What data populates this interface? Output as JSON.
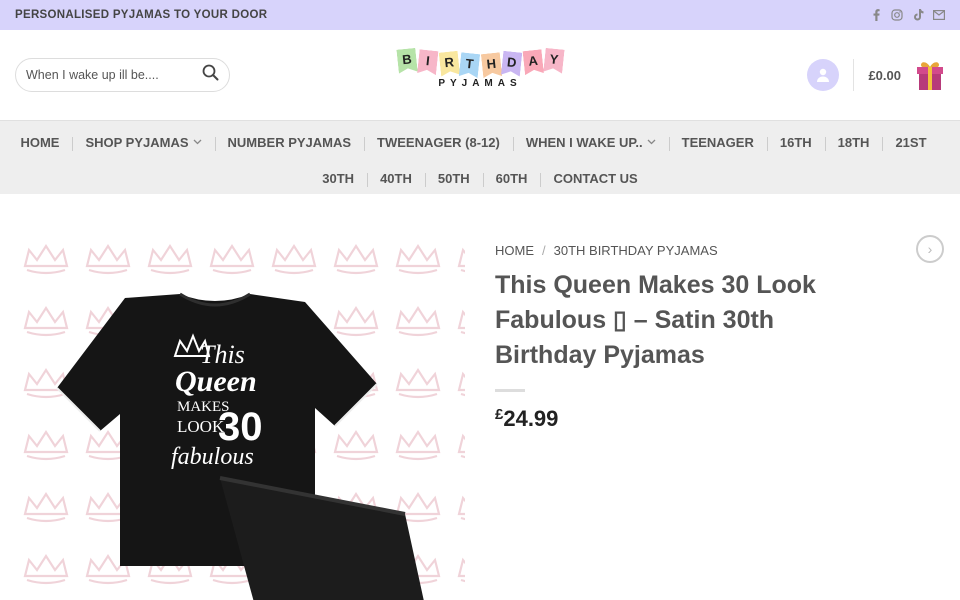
{
  "topbar": {
    "promo": "PERSONALISED PYJAMAS TO YOUR DOOR",
    "social": [
      "facebook-icon",
      "instagram-icon",
      "tiktok-icon",
      "email-icon"
    ]
  },
  "header": {
    "search_placeholder": "When I wake up ill be....",
    "logo_letters": [
      "B",
      "I",
      "R",
      "T",
      "H",
      "D",
      "A",
      "Y"
    ],
    "logo_colors": [
      "#b6e3a8",
      "#f7b6c8",
      "#f9e79f",
      "#a9d6f5",
      "#f7c9a0",
      "#c9b6f2",
      "#f9a8b8",
      "#f7b6c8"
    ],
    "logo_sub": "PYJAMAS",
    "cart_total": "£0.00"
  },
  "nav": {
    "row1": [
      {
        "label": "HOME",
        "dropdown": false
      },
      {
        "label": "SHOP PYJAMAS",
        "dropdown": true
      },
      {
        "label": "NUMBER PYJAMAS",
        "dropdown": false
      },
      {
        "label": "TWEENAGER (8-12)",
        "dropdown": false
      },
      {
        "label": "WHEN I WAKE UP..",
        "dropdown": true
      },
      {
        "label": "TEENAGER",
        "dropdown": false
      },
      {
        "label": "16TH",
        "dropdown": false
      },
      {
        "label": "18TH",
        "dropdown": false
      },
      {
        "label": "21ST",
        "dropdown": false
      }
    ],
    "row2": [
      {
        "label": "30TH",
        "dropdown": false
      },
      {
        "label": "40TH",
        "dropdown": false
      },
      {
        "label": "50TH",
        "dropdown": false
      },
      {
        "label": "60TH",
        "dropdown": false
      },
      {
        "label": "CONTACT US",
        "dropdown": false
      }
    ]
  },
  "product": {
    "breadcrumb_home": "HOME",
    "breadcrumb_sep": "/",
    "breadcrumb_category": "30TH BIRTHDAY PYJAMAS",
    "title": "This Queen Makes 30 Look Fabulous ▯ – Satin 30th Birthday Pyjamas",
    "price_currency": "£",
    "price_value": "24.99",
    "image_text": {
      "line1": "This",
      "line2": "Queen",
      "line3": "MAKES",
      "line4": "LOOK",
      "number": "30",
      "line5": "fabulous"
    }
  },
  "colors": {
    "topbar_bg": "#d7d3fb",
    "nav_bg": "#eeeeee",
    "crown_pattern": "#f2d7dc",
    "pyjama": "#141414"
  }
}
